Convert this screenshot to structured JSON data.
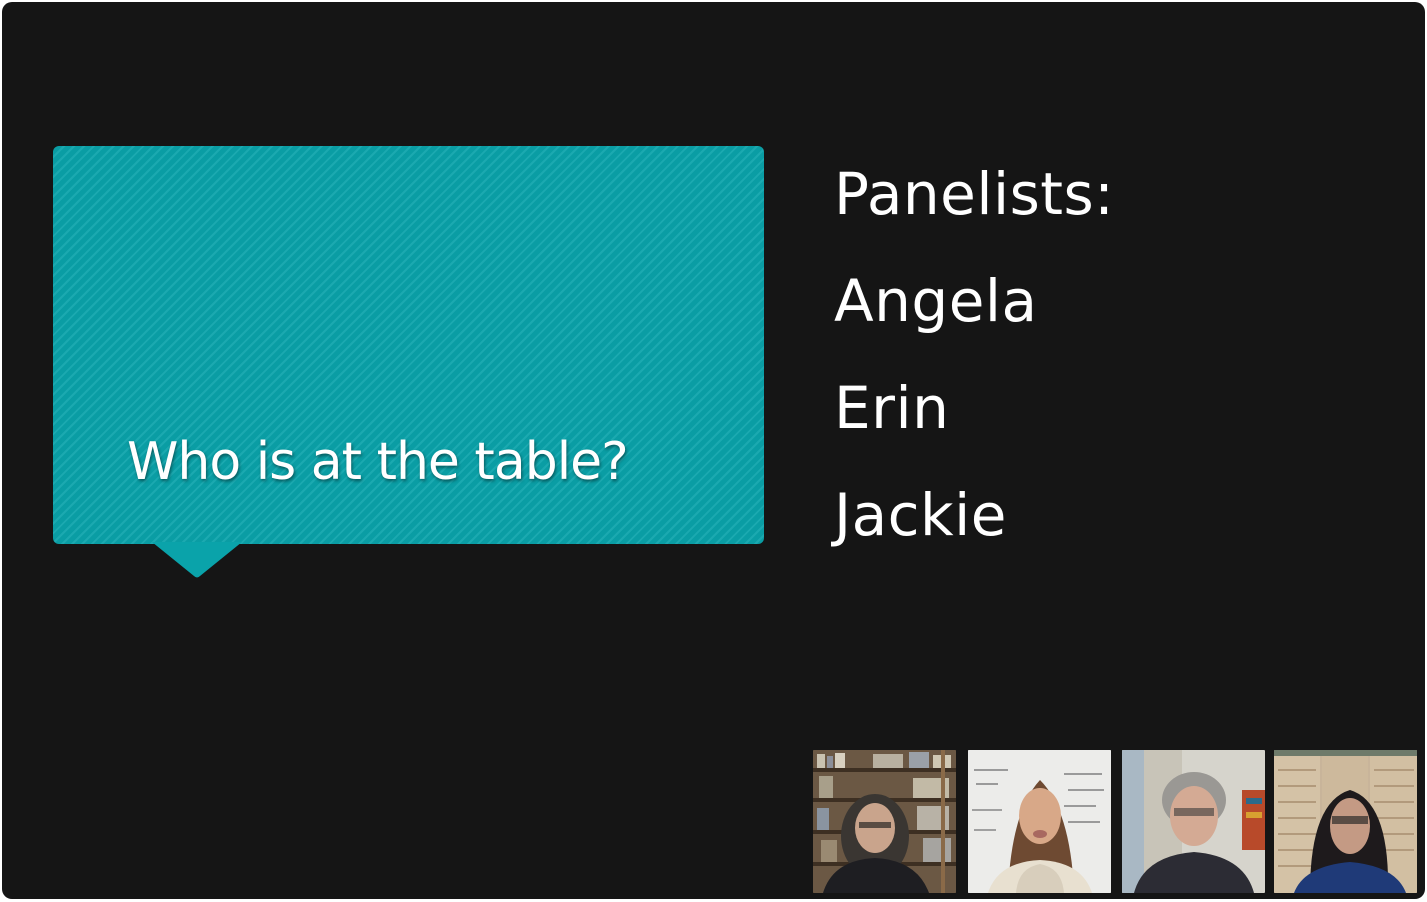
{
  "slide": {
    "callout_title": "Who is at the table?",
    "panel_heading": "Panelists:",
    "panelists": [
      "Angela",
      "Erin",
      "Jackie"
    ]
  },
  "colors": {
    "slide_background": "#151515",
    "callout_fill": "#0aa3aa",
    "text": "#ffffff"
  },
  "video_tiles": [
    {
      "id": "participant-1",
      "background": "bookshelf"
    },
    {
      "id": "participant-2",
      "background": "whiteboard"
    },
    {
      "id": "participant-3",
      "background": "room-wall"
    },
    {
      "id": "participant-4",
      "background": "woven-screen"
    }
  ]
}
